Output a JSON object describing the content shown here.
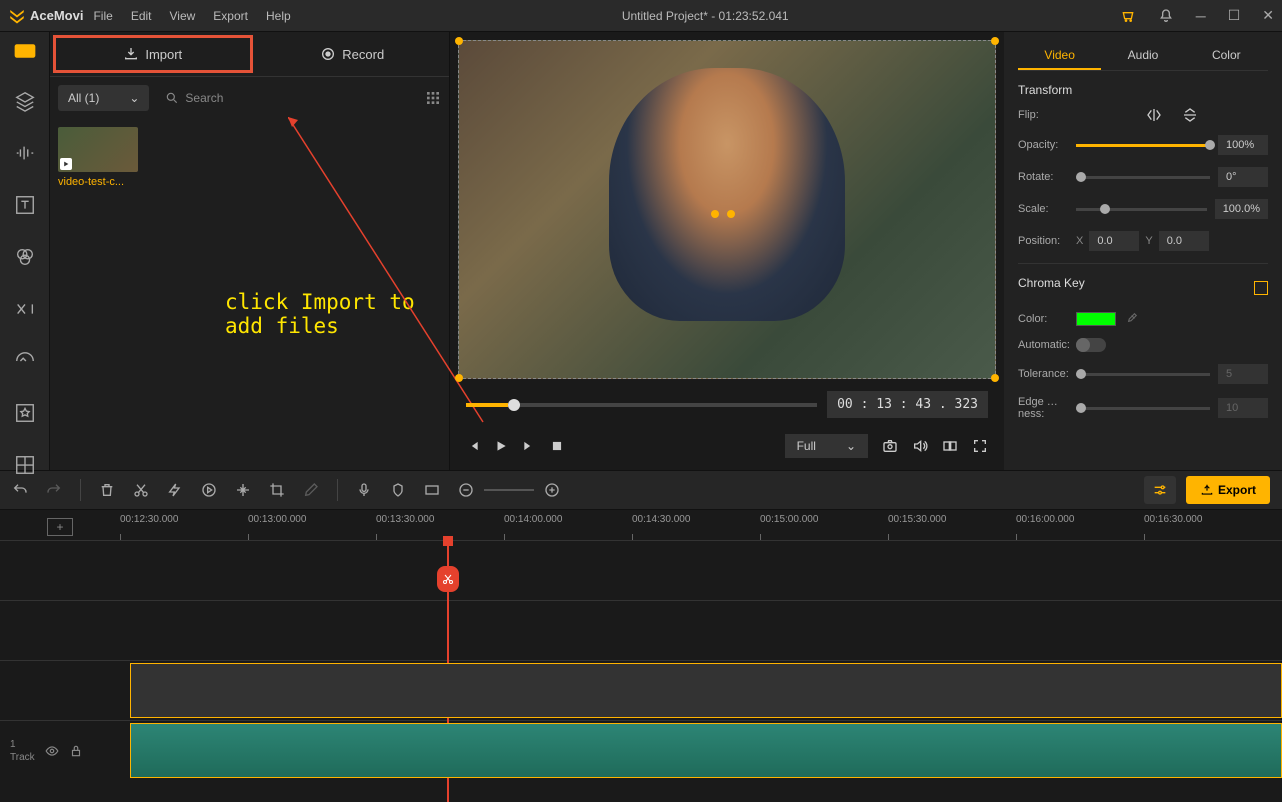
{
  "app": {
    "name": "AceMovi",
    "title": "Untitled Project* - 01:23:52.041"
  },
  "menu": [
    "File",
    "Edit",
    "View",
    "Export",
    "Help"
  ],
  "tabs": {
    "import": "Import",
    "record": "Record"
  },
  "filter": {
    "dropdown": "All (1)",
    "search_placeholder": "Search"
  },
  "thumb": {
    "label": "video-test-c..."
  },
  "annotation": {
    "text": "click Import to add files"
  },
  "preview": {
    "timecode": "00 : 13 : 43 . 323",
    "full": "Full"
  },
  "props": {
    "tabs": [
      "Video",
      "Audio",
      "Color"
    ],
    "transform": "Transform",
    "flip": "Flip:",
    "opacity": {
      "label": "Opacity:",
      "value": "100%"
    },
    "rotate": {
      "label": "Rotate:",
      "value": "0°"
    },
    "scale": {
      "label": "Scale:",
      "value": "100.0%"
    },
    "position": {
      "label": "Position:",
      "x_label": "X",
      "x": "0.0",
      "y_label": "Y",
      "y": "0.0"
    },
    "chroma": {
      "title": "Chroma Key",
      "color": "Color:",
      "auto": "Automatic:",
      "tol": {
        "label": "Tolerance:",
        "value": "5"
      },
      "edge": {
        "label": "Edge …ness:",
        "value": "10"
      }
    }
  },
  "export": "Export",
  "timeline": {
    "stamps": [
      "00:12:30.000",
      "00:13:00.000",
      "00:13:30.000",
      "00:14:00.000",
      "00:14:30.000",
      "00:15:00.000",
      "00:15:30.000",
      "00:16:00.000",
      "00:16:30.000"
    ],
    "track_label": "Track",
    "track_num": "1"
  }
}
